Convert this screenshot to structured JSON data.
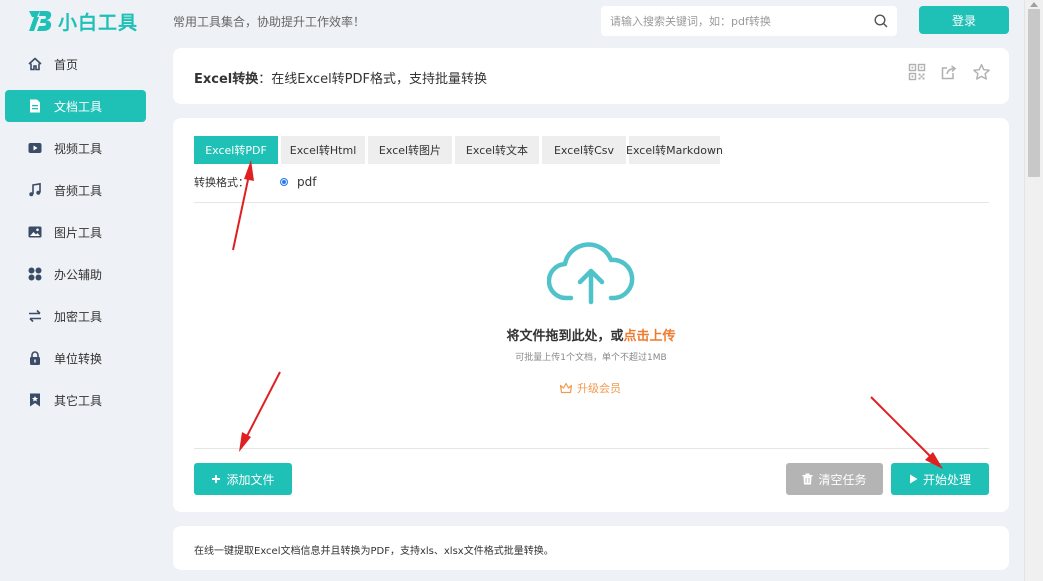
{
  "app": {
    "name": "小白工具",
    "tagline": "常用工具集合，协助提升工作效率！"
  },
  "search": {
    "placeholder": "请输入搜索关键词，如：pdf转换"
  },
  "login_label": "登录",
  "sidebar": {
    "items": [
      {
        "label": "首页",
        "icon": "home-icon",
        "active": false
      },
      {
        "label": "文档工具",
        "icon": "document-icon",
        "active": true
      },
      {
        "label": "视频工具",
        "icon": "video-icon",
        "active": false
      },
      {
        "label": "音频工具",
        "icon": "music-icon",
        "active": false
      },
      {
        "label": "图片工具",
        "icon": "image-icon",
        "active": false
      },
      {
        "label": "办公辅助",
        "icon": "grid-icon",
        "active": false
      },
      {
        "label": "加密工具",
        "icon": "swap-icon",
        "active": false
      },
      {
        "label": "单位转换",
        "icon": "lock-icon",
        "active": false
      },
      {
        "label": "其它工具",
        "icon": "bookmark-icon",
        "active": false
      }
    ]
  },
  "page": {
    "title_bold": "Excel转换",
    "title_rest": "：在线Excel转PDF格式，支持批量转换",
    "actions": [
      "qrcode-icon",
      "share-icon",
      "star-icon"
    ]
  },
  "tabs": [
    {
      "label": "Excel转PDF",
      "active": true
    },
    {
      "label": "Excel转Html",
      "active": false
    },
    {
      "label": "Excel转图片",
      "active": false
    },
    {
      "label": "Excel转文本",
      "active": false
    },
    {
      "label": "Excel转Csv",
      "active": false
    },
    {
      "label": "Excel转Markdown",
      "active": false
    }
  ],
  "format": {
    "label": "转换格式：",
    "selected": "pdf"
  },
  "upload": {
    "drop_text": "将文件拖到此处，或",
    "drop_link": "点击上传",
    "limit": "可批量上传1个文档，单个不超过1MB",
    "upgrade": "升级会员"
  },
  "buttons": {
    "add": "添加文件",
    "clear": "清空任务",
    "start": "开始处理"
  },
  "description": "在线一键提取Excel文档信息并且转换为PDF，支持xls、xlsx文件格式批量转换。",
  "colors": {
    "accent": "#1fc0b6",
    "link": "#ef7a2e",
    "upgrade": "#f09b4d",
    "arrow": "#e02020",
    "disabled": "#b4b4b4"
  }
}
